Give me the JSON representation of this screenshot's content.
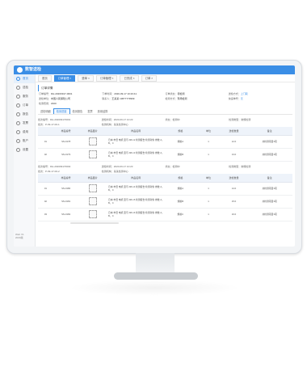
{
  "app": {
    "title": "数智送检"
  },
  "sidebar": {
    "items": [
      {
        "label": "首页"
      },
      {
        "label": "送检"
      },
      {
        "label": "服务"
      },
      {
        "label": "订单"
      },
      {
        "label": "报告"
      },
      {
        "label": "发票"
      },
      {
        "label": "费用"
      },
      {
        "label": "账户"
      },
      {
        "label": "设置"
      }
    ],
    "footer": [
      "Web V1",
      "2020版"
    ]
  },
  "tabs": [
    {
      "label": "首页",
      "active": false
    },
    {
      "label": "订单管理 ×",
      "active": true
    },
    {
      "label": "退单 ×",
      "active": false
    },
    {
      "label": "订单管理 ×",
      "active": false
    },
    {
      "label": "已完成 ×",
      "active": false
    },
    {
      "label": "订单 ×",
      "active": false
    }
  ],
  "order_info": {
    "section_title": "订单详情",
    "fields": [
      {
        "label": "订单编号：",
        "value": "DH-20200917-0001"
      },
      {
        "label": "下单时间：",
        "value": "2020-09-17 10:23:41"
      },
      {
        "label": "订单状态：",
        "value": "待检测"
      },
      {
        "label": "送检方式：",
        "value": "上门取"
      },
      {
        "label": "送检单位：",
        "value": "中国人民保险公司"
      },
      {
        "label": "联系人：",
        "value": "王某某 13877779999"
      },
      {
        "label": "检测方式：",
        "value": "现场检测"
      },
      {
        "label": "快递单号：",
        "value": "无"
      },
      {
        "label": "检测费用：",
        "value": "¥400"
      }
    ]
  },
  "subtabs": [
    {
      "label": "送检明细",
      "active": false
    },
    {
      "label": "检测进度",
      "active": true
    },
    {
      "label": "检测报告",
      "active": false
    },
    {
      "label": "发票",
      "active": false
    },
    {
      "label": "费用结算",
      "active": false
    }
  ],
  "columns": [
    "样品编号",
    "样品图片",
    "样品名称",
    "规格",
    "单位",
    "送检数量",
    "实测数量",
    "备注"
  ],
  "blocks": [
    {
      "head": [
        "批次编号：DH-202009170001",
        "送检时间：2020-09-17 10:23",
        "状态：检测中",
        "检测类型：常规检测"
      ],
      "head2": [
        "批次：P-09-17-00-1",
        "检测机构：某某检测中心",
        "",
        ""
      ],
      "rows": [
        {
          "no": "01",
          "code": "SN-0178",
          "name": "日本 丰田 电机 型号 AB-12 检测报告 检测对象 参数 A，B，C",
          "spec": "规格A",
          "unit": "个",
          "qty": "1",
          "actual": "12.0",
          "remark": "共检测项目3项"
        },
        {
          "no": "02",
          "code": "SN-0179",
          "name": "日本 丰田 电机 型号 AB-13 检测报告 检测对象 参数 A，B，C",
          "spec": "规格B",
          "unit": "个",
          "qty": "1",
          "actual": "13.0",
          "remark": "共检测项目3项"
        }
      ],
      "add_link": "添加 查看详情"
    },
    {
      "head": [
        "批次编号：DH-202009170002",
        "送检时间：2020-09-17 10:23",
        "状态：检测中",
        "检测类型：常规检测"
      ],
      "head2": [
        "批次：P-09-17-00-2",
        "检测机构：某某检测中心",
        "",
        ""
      ],
      "rows": [
        {
          "no": "01",
          "code": "SN-0180",
          "name": "日本 丰田 电机 型号 AB-14 检测报告 检测对象 参数 A，B，C",
          "spec": "规格A",
          "unit": "个",
          "qty": "1",
          "actual": "14.0",
          "remark": "共检测项目3项"
        },
        {
          "no": "02",
          "code": "SN-0181",
          "name": "日本 丰田 电机 型号 AB-15 检测报告 检测对象 参数 A，B，C",
          "spec": "规格B",
          "unit": "个",
          "qty": "1",
          "actual": "15.0",
          "remark": "共检测项目3项"
        },
        {
          "no": "03",
          "code": "SN-0182",
          "name": "日本 丰田 电机 型号 AB-16 检测报告 检测对象 参数 A，B，C",
          "spec": "规格C",
          "unit": "个",
          "qty": "1",
          "actual": "16.0",
          "remark": "共检测项目3项"
        }
      ],
      "add_link": ""
    }
  ],
  "colors": {
    "accent": "#3a8ee6"
  }
}
